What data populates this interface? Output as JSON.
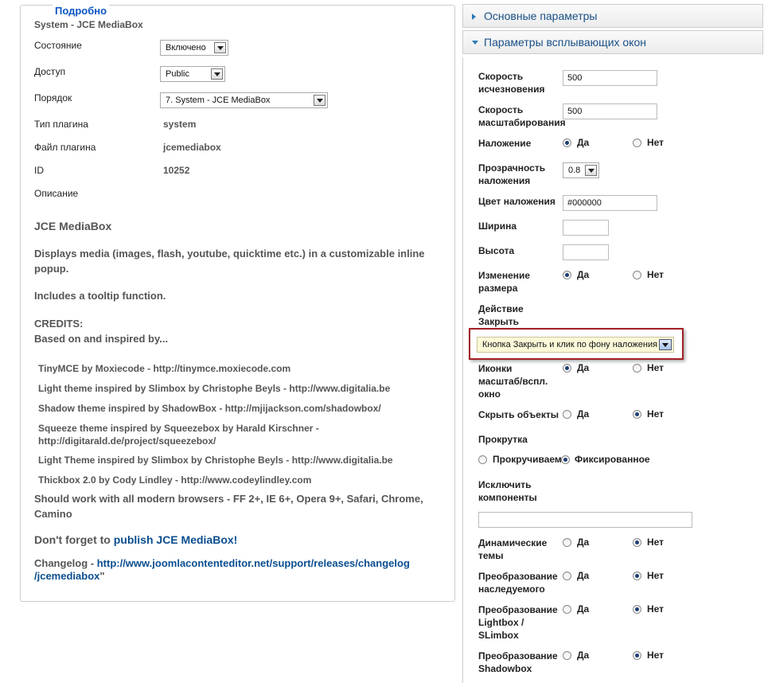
{
  "left": {
    "legend": "Подробно",
    "subtitle": "System - JCE MediaBox",
    "fields": {
      "state_label": "Состояние",
      "state_value": "Включено",
      "access_label": "Доступ",
      "access_value": "Public",
      "order_label": "Порядок",
      "order_value": "7. System - JCE MediaBox",
      "type_label": "Тип плагина",
      "type_value": "system",
      "file_label": "Файл плагина",
      "file_value": "jcemediabox",
      "id_label": "ID",
      "id_value": "10252",
      "desc_label": "Описание"
    },
    "description": {
      "heading": "JCE MediaBox",
      "p1": "Displays media (images, flash, youtube, quicktime etc.) in a customizable inline popup.",
      "p2": "Includes a tooltip function.",
      "credits_1": "CREDITS:",
      "credits_2": "Based on and inspired by...",
      "credit_items": [
        "TinyMCE by Moxiecode - http://tinymce.moxiecode.com",
        "Light theme inspired by Slimbox by Christophe Beyls - http://www.digitalia.be",
        "Shadow theme inspired by ShadowBox - http://mjijackson.com/shadowbox/",
        "Squeeze theme inspired by Squeezebox by Harald Kirschner - http://digitarald.de/project/squeezebox/",
        "Light Theme inspired by Slimbox by Christophe Beyls - http://www.digitalia.be",
        "Thickbox 2.0 by Cody Lindley - http://www.codeylindley.com"
      ],
      "browsers": "Should work with all modern browsers - FF 2+, IE 6+, Opera 9+, Safari, Chrome, Camino",
      "publish_prefix": "Don't forget to ",
      "publish_link": "publish JCE MediaBox!",
      "changelog_prefix": "Changelog - ",
      "changelog_link_1": "http://www.joomlacontenteditor.net/support/releases/changelog",
      "changelog_link_2": "/jcemediabox",
      "changelog_suffix": "\""
    }
  },
  "right": {
    "panel1_title": "Основные параметры",
    "panel2_title": "Параметры всплывающих окон",
    "yes": "Да",
    "no": "Нет",
    "fade_label": "Скорость исчезновения",
    "fade_value": "500",
    "scale_label": "Скорость масштабирования",
    "scale_value": "500",
    "overlay_label": "Наложение",
    "opacity_label": "Прозрачность наложения",
    "opacity_value": "0.8",
    "color_label": "Цвет наложения",
    "color_value": "#000000",
    "width_label": "Ширина",
    "height_label": "Высота",
    "resize_label": "Изменение размера",
    "close_label": "Действие Закрыть",
    "close_value": "Кнопка Закрыть и клик по фону наложения",
    "icons_label": "Иконки масштаб/вспл. окно",
    "hide_label": "Скрыть объекты",
    "scroll_label": "Прокрутка",
    "scroll_opt1": "Прокручиваем",
    "scroll_opt2": "Фиксированное",
    "exclude_label": "Исключить компоненты",
    "dyn_label": "Динамические темы",
    "conv_legacy_label": "Преобразование наследуемого",
    "conv_lightbox_label": "Преобразование Lightbox / SLimbox",
    "conv_shadowbox_label": "Преобразование Shadowbox"
  },
  "colors": {
    "accent": "#1a5087",
    "highlight_border": "#a02025",
    "link": "#0b4e8f"
  }
}
